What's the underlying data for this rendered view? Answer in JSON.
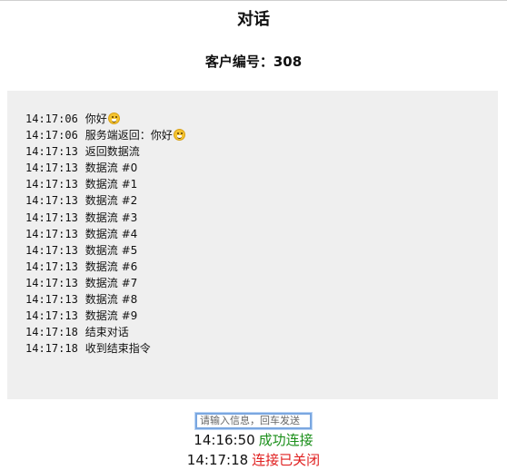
{
  "page": {
    "title": "对话",
    "client_label": "客户编号：",
    "client_id": "308"
  },
  "log": [
    {
      "time": "14:17:06",
      "message": "你好",
      "emoji": true
    },
    {
      "time": "14:17:06",
      "message": "服务端返回：你好",
      "emoji": true
    },
    {
      "time": "14:17:13",
      "message": "返回数据流",
      "emoji": false
    },
    {
      "time": "14:17:13",
      "message": "数据流 #0",
      "emoji": false
    },
    {
      "time": "14:17:13",
      "message": "数据流 #1",
      "emoji": false
    },
    {
      "time": "14:17:13",
      "message": "数据流 #2",
      "emoji": false
    },
    {
      "time": "14:17:13",
      "message": "数据流 #3",
      "emoji": false
    },
    {
      "time": "14:17:13",
      "message": "数据流 #4",
      "emoji": false
    },
    {
      "time": "14:17:13",
      "message": "数据流 #5",
      "emoji": false
    },
    {
      "time": "14:17:13",
      "message": "数据流 #6",
      "emoji": false
    },
    {
      "time": "14:17:13",
      "message": "数据流 #7",
      "emoji": false
    },
    {
      "time": "14:17:13",
      "message": "数据流 #8",
      "emoji": false
    },
    {
      "time": "14:17:13",
      "message": "数据流 #9",
      "emoji": false
    },
    {
      "time": "14:17:18",
      "message": "结束对话",
      "emoji": false
    },
    {
      "time": "14:17:18",
      "message": "收到结束指令",
      "emoji": false
    }
  ],
  "input": {
    "placeholder": "请输入信息，回车发送",
    "value": ""
  },
  "status": [
    {
      "time": "14:16:50",
      "text": "成功连接",
      "color": "#1a8f1a"
    },
    {
      "time": "14:17:18",
      "text": "连接已关闭",
      "color": "#e02020"
    }
  ],
  "emoji_icon": "grinning-face-icon"
}
